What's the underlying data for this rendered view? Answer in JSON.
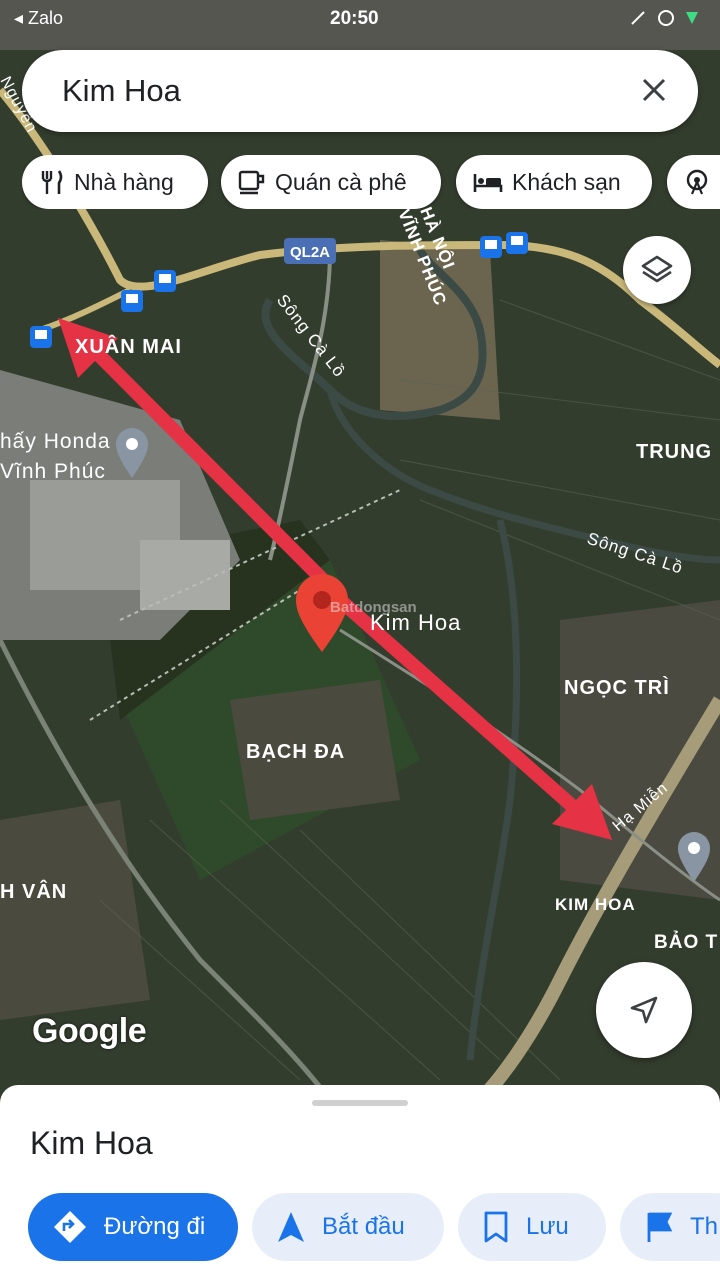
{
  "status_bar": {
    "back_app": "◂ Zalo",
    "time": "20:50"
  },
  "search": {
    "query": "Kim Hoa"
  },
  "chips": [
    {
      "label": "Nhà hàng",
      "icon": "fork-knife-icon"
    },
    {
      "label": "Quán cà phê",
      "icon": "coffee-cup-icon"
    },
    {
      "label": "Khách sạn",
      "icon": "bed-icon"
    },
    {
      "label": "",
      "icon": "ferris-wheel-icon"
    }
  ],
  "map": {
    "road_badge": "QL2A",
    "labels": {
      "xuan_mai": "XUÂN MAI",
      "honda_1": "hấy Honda",
      "honda_2": "Vĩnh Phúc",
      "song_ca_lo_1": "Sông Cà Lồ",
      "song_ca_lo_2": "Sông Cà Lồ",
      "vinh_phuc": "VĨNH PHÚC",
      "ha_noi": "HÀ NỘI",
      "trung": "TRUNG",
      "kim_hoa_pin": "Kim Hoa",
      "ngoc_tri": "NGỌC TRÌ",
      "bach_da": "BẠCH ĐA",
      "h_van": "H VÂN",
      "kim_hoa": "KIM HOA",
      "bao": "BẢO T",
      "ha_mien": "Hạ Miễn",
      "nguyen": "Nguyễn",
      "watermark": "Batdongsan"
    },
    "google_logo": "Google",
    "colors": {
      "route_arrow": "#e53245",
      "pin": "#ea4335",
      "water": "#3c4a45"
    }
  },
  "sheet": {
    "place_name": "Kim Hoa",
    "buttons": [
      {
        "label": "Đường đi",
        "icon": "directions-icon"
      },
      {
        "label": "Bắt đầu",
        "icon": "navigation-arrow-icon"
      },
      {
        "label": "Lưu",
        "icon": "bookmark-icon"
      },
      {
        "label": "Th",
        "icon": "flag-icon"
      }
    ]
  }
}
